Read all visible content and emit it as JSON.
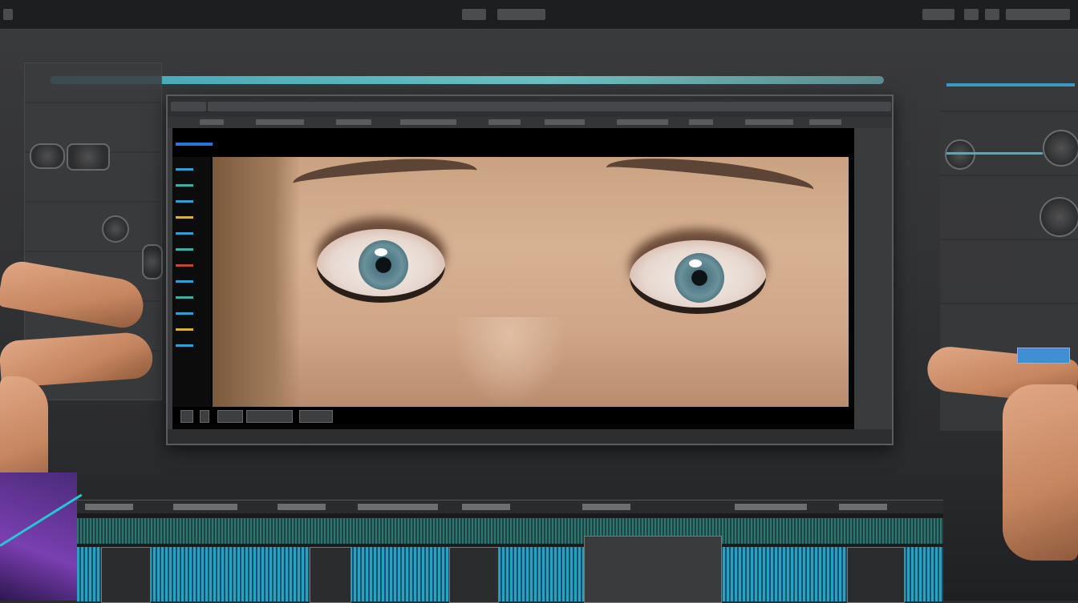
{
  "topbar": {
    "controls": 7
  },
  "monitor": {
    "menu": [
      "",
      "",
      "",
      "",
      "",
      "",
      "",
      "",
      "",
      "",
      "",
      "",
      "",
      "",
      "",
      ""
    ],
    "header": {
      "left_label": "",
      "mid_label": "",
      "right_label": ""
    }
  },
  "colors": {
    "accent_teal": "#3fa7b5",
    "accent_blue": "#2b73d9",
    "clip_blue": "#2aa0c4",
    "waveform": "#2f7f78"
  },
  "icons": [
    "gear-icon",
    "settings-icon",
    "dial-icon"
  ]
}
